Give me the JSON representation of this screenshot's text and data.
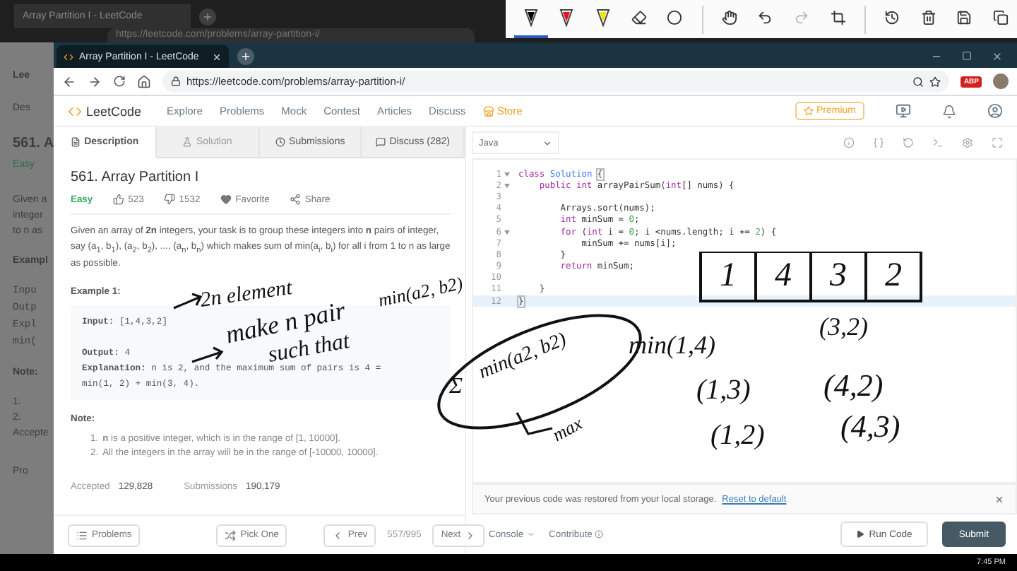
{
  "background_page": {
    "tab_title": "Array Partition I - LeetCode",
    "url": "https://leetcode.com/problems/array-partition-i/",
    "peek_texts": [
      {
        "kind": "logo",
        "text": "Lee"
      },
      {
        "kind": "tab",
        "text": "Des"
      },
      {
        "kind": "title",
        "text": "561. A"
      },
      {
        "kind": "easy",
        "text": "Easy"
      },
      {
        "kind": "body",
        "text": "Given a"
      },
      {
        "kind": "body",
        "text": "integer"
      },
      {
        "kind": "body",
        "text": "to n as"
      },
      {
        "kind": "heading",
        "text": "Exampl"
      },
      {
        "kind": "code",
        "text": "Inpu"
      },
      {
        "kind": "code",
        "text": "Outp"
      },
      {
        "kind": "code",
        "text": "Expl"
      },
      {
        "kind": "code",
        "text": "min("
      },
      {
        "kind": "heading",
        "text": "Note:"
      },
      {
        "kind": "body",
        "text": "1."
      },
      {
        "kind": "body",
        "text": "2."
      },
      {
        "kind": "body",
        "text": "Accepte"
      },
      {
        "kind": "button",
        "text": "Pro"
      }
    ]
  },
  "ink_toolbar": {
    "pens": [
      {
        "color": "#000000",
        "selected": true
      },
      {
        "color": "#e81123",
        "selected": false
      },
      {
        "color": "#f2e600",
        "selected": false
      }
    ],
    "redo_disabled": true
  },
  "browser": {
    "tab_title": "Array Partition I - LeetCode",
    "url": "https://leetcode.com/problems/array-partition-i/",
    "extension_badge": "ABP"
  },
  "nav": {
    "logo": "LeetCode",
    "links": [
      "Explore",
      "Problems",
      "Mock",
      "Contest",
      "Articles",
      "Discuss"
    ],
    "store": "Store",
    "premium": "Premium"
  },
  "problem_tabs": [
    {
      "label": "Description",
      "selected": true,
      "disabled": false
    },
    {
      "label": "Solution",
      "selected": false,
      "disabled": true
    },
    {
      "label": "Submissions",
      "selected": false,
      "disabled": false
    },
    {
      "label": "Discuss (282)",
      "selected": false,
      "disabled": false
    }
  ],
  "problem": {
    "title": "561. Array Partition I",
    "difficulty": "Easy",
    "likes": "523",
    "dislikes": "1532",
    "favorite": "Favorite",
    "share": "Share",
    "description": "Given an array of **2n** integers, your task is to group these integers into **n** pairs of integer, say (a$_{1}$, b$_{1}$), (a$_{2}$, b$_{2}$), ..., (a$_{n}$, b$_{n}$) which makes sum of min(a$_{i}$, b$_{i}$) for all i from 1 to n as large as possible.",
    "example_heading": "Example 1:",
    "example_lines": [
      "**Input:** [1,4,3,2]",
      "**Output:** 4",
      "**Explanation:** n is 2, and the maximum sum of pairs is 4 = min(1, 2) + min(3, 4)."
    ],
    "note_heading": "Note:",
    "notes": [
      {
        "marker": "1.",
        "text": "**n** is a positive integer, which is in the range of [1, 10000]."
      },
      {
        "marker": "2.",
        "text": "All the integers in the array will be in the range of [-10000, 10000]."
      }
    ],
    "stats": [
      {
        "label": "Accepted",
        "value": "129,828"
      },
      {
        "label": "Submissions",
        "value": "190,179"
      }
    ]
  },
  "footer": {
    "problems": "Problems",
    "pick_one": "Pick One",
    "prev": "Prev",
    "position": "557/995",
    "next": "Next"
  },
  "editor": {
    "language": "Java",
    "lines": [
      {
        "number": "1",
        "foldable": true,
        "selected": false,
        "tokens": [
          {
            "kind": "kw",
            "text": "class"
          },
          {
            "kind": "type",
            "text": " Solution "
          },
          {
            "kind": "match",
            "text": "{"
          }
        ]
      },
      {
        "number": "2",
        "foldable": true,
        "selected": false,
        "tokens": [
          {
            "kind": "kw",
            "text": "    public int"
          },
          {
            "kind": "plain",
            "text": " arrayPairSum("
          },
          {
            "kind": "kw",
            "text": "int"
          },
          {
            "kind": "plain",
            "text": "[] nums) {"
          }
        ]
      },
      {
        "number": "3",
        "foldable": false,
        "selected": false
      },
      {
        "number": "4",
        "foldable": false,
        "selected": false,
        "tokens": [
          {
            "kind": "plain",
            "text": "        Arrays.sort(nums);"
          }
        ]
      },
      {
        "number": "5",
        "foldable": false,
        "selected": false,
        "tokens": [
          {
            "kind": "kw",
            "text": "        int"
          },
          {
            "kind": "plain",
            "text": " minSum = "
          },
          {
            "kind": "num",
            "text": "0"
          },
          {
            "kind": "plain",
            "text": ";"
          }
        ]
      },
      {
        "number": "6",
        "foldable": true,
        "selected": false,
        "tokens": [
          {
            "kind": "kw",
            "text": "        for"
          },
          {
            "kind": "plain",
            "text": " ("
          },
          {
            "kind": "kw",
            "text": "int"
          },
          {
            "kind": "plain",
            "text": " i = "
          },
          {
            "kind": "num",
            "text": "0"
          },
          {
            "kind": "plain",
            "text": "; i <nums.length; i += "
          },
          {
            "kind": "num",
            "text": "2"
          },
          {
            "kind": "plain",
            "text": ") {"
          }
        ]
      },
      {
        "number": "7",
        "foldable": false,
        "selected": false,
        "tokens": [
          {
            "kind": "plain",
            "text": "            minSum += nums[i];"
          }
        ]
      },
      {
        "number": "8",
        "foldable": false,
        "selected": false,
        "tokens": [
          {
            "kind": "plain",
            "text": "        }"
          }
        ]
      },
      {
        "number": "9",
        "foldable": false,
        "selected": false,
        "tokens": [
          {
            "kind": "kw",
            "text": "        return"
          },
          {
            "kind": "plain",
            "text": " minSum;"
          }
        ]
      },
      {
        "number": "10",
        "foldable": false,
        "selected": false
      },
      {
        "number": "11",
        "foldable": false,
        "selected": false,
        "tokens": [
          {
            "kind": "plain",
            "text": "    }"
          }
        ]
      },
      {
        "number": "12",
        "foldable": false,
        "selected": true,
        "tokens": [
          {
            "kind": "match",
            "text": "}"
          }
        ]
      }
    ],
    "notice": "Your previous code was restored from your local storage.",
    "reset_link": "Reset to default",
    "console": "Console",
    "contribute": "Contribute",
    "run": "Run Code",
    "submit": "Submit"
  },
  "annotations": [
    "2n element",
    "make n pair",
    "such that",
    "min(a2, b2)",
    "Σ",
    "min(a2, b2)",
    "max",
    "min(1,4)",
    "(3,2)",
    "(1,3)",
    "(4,2)",
    "(1,2)",
    "(4,3)"
  ],
  "array_sketch": [
    "1",
    "4",
    "3",
    "2"
  ],
  "taskbar": {
    "time": "7:45 PM"
  }
}
